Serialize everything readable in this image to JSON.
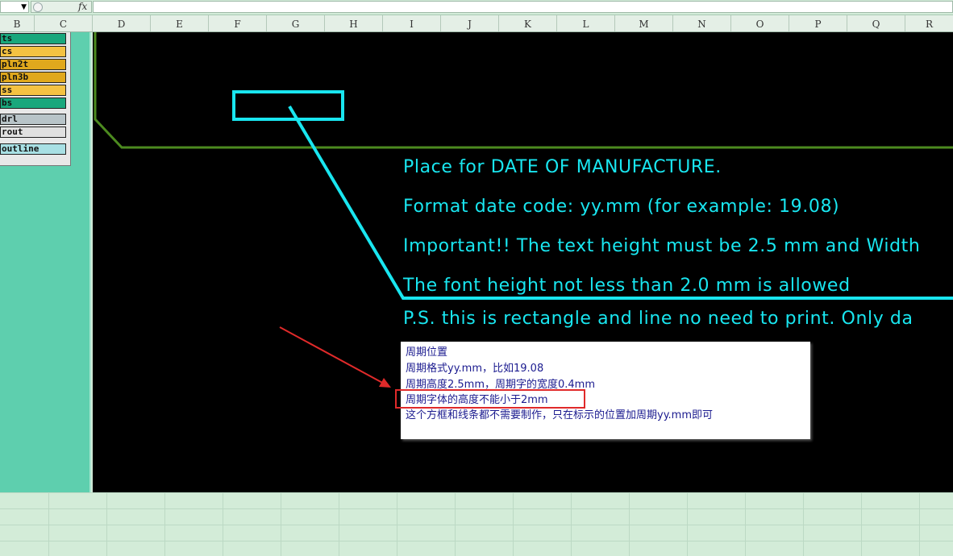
{
  "formula_bar": {
    "fx_label": "fx",
    "name_box_value": "",
    "formula_value": ""
  },
  "columns": [
    "B",
    "C",
    "D",
    "E",
    "F",
    "G",
    "H",
    "I",
    "J",
    "K",
    "L",
    "M",
    "N",
    "O",
    "P",
    "Q",
    "R"
  ],
  "layers": [
    {
      "label": "ts",
      "color": "#19a77c"
    },
    {
      "label": "cs",
      "color": "#f4c242"
    },
    {
      "label": "pln2t",
      "color": "#e0a81d"
    },
    {
      "label": "pln3b",
      "color": "#e0a81d"
    },
    {
      "label": "ss",
      "color": "#f4c242"
    },
    {
      "label": "bs",
      "color": "#19a77c"
    },
    {
      "label": "drl",
      "color": "#b8c4c8"
    },
    {
      "label": "rout",
      "color": "#e0e0e0"
    },
    {
      "label": "outline",
      "color": "#a8e0e4"
    }
  ],
  "cad_lines": [
    "Place for DATE OF MANUFACTURE.",
    "Format date code: yy.mm (for example: 19.08)",
    "Important!! The text height must be 2.5 mm and Width",
    "The font height not less than 2.0 mm is allowed",
    "P.S. this is rectangle and line no need to print. Only da"
  ],
  "note_lines": [
    "周期位置",
    "周期格式yy.mm，比如19.08",
    "周期高度2.5mm，周期字的宽度0.4mm",
    "周期字体的高度不能小于2mm",
    "这个方框和线条都不需要制作，只在标示的位置加周期yy.mm即可"
  ],
  "colors": {
    "cad_cyan": "#19e6f0",
    "outline_green": "#4c8a1f",
    "arrow_red": "#e02a2a",
    "panel_teal": "#5ecfae"
  }
}
